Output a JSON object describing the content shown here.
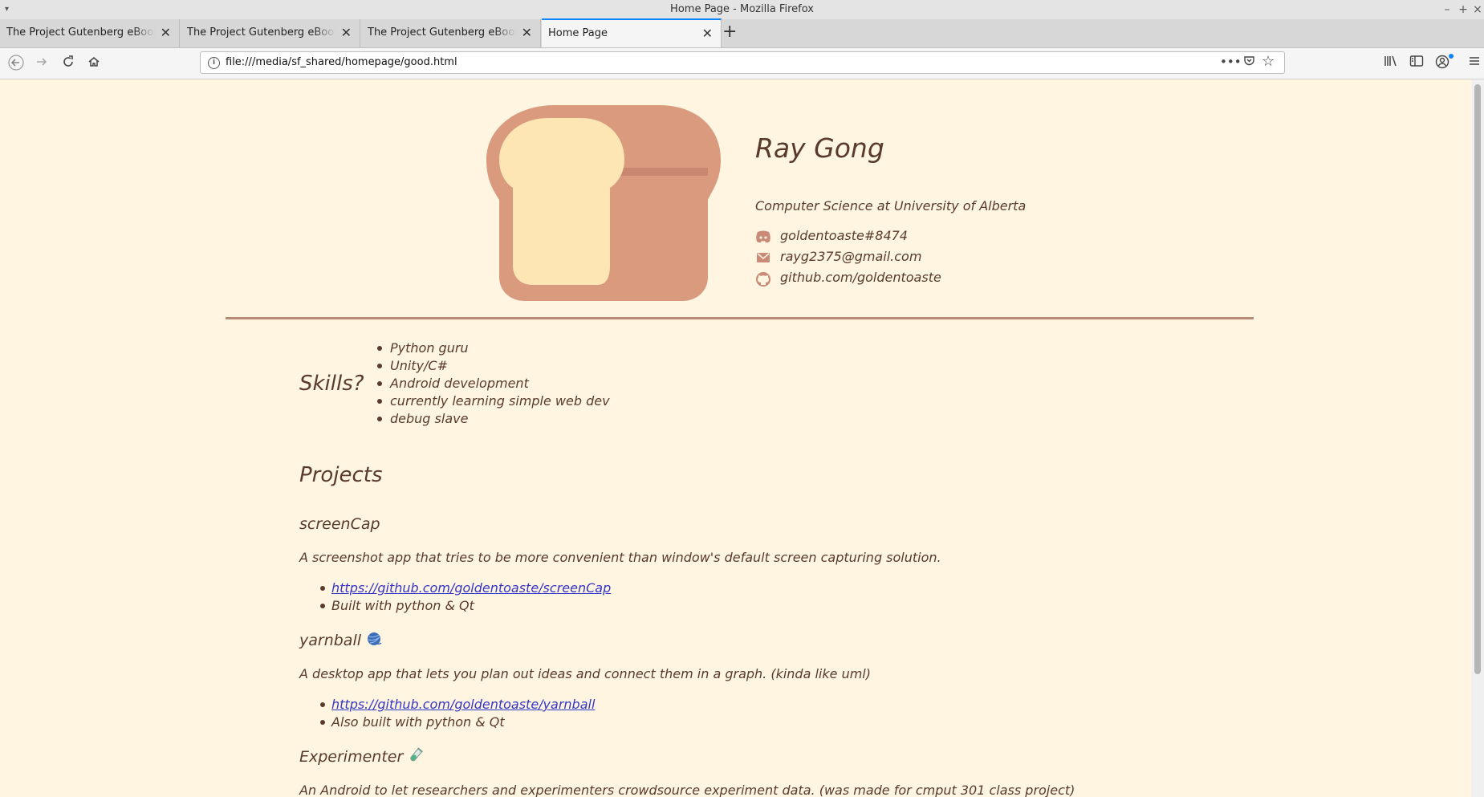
{
  "window": {
    "title": "Home Page - Mozilla Firefox"
  },
  "tabs": [
    {
      "label": "The Project Gutenberg eBook of",
      "active": false
    },
    {
      "label": "The Project Gutenberg eBook of",
      "active": false
    },
    {
      "label": "The Project Gutenberg eBook of",
      "active": false
    },
    {
      "label": "Home Page",
      "active": true
    }
  ],
  "navbar": {
    "url": "file:///media/sf_shared/homepage/good.html"
  },
  "profile": {
    "name": "Ray Gong",
    "subtitle": "Computer Science at University of Alberta",
    "contacts": [
      {
        "icon": "discord-icon",
        "text": "goldentoaste#8474"
      },
      {
        "icon": "mail-icon",
        "text": "rayg2375@gmail.com"
      },
      {
        "icon": "github-icon",
        "text": "github.com/goldentoaste"
      }
    ]
  },
  "skills": {
    "title": "Skills?",
    "items": [
      "Python guru",
      "Unity/C#",
      "Android development",
      "currently learning simple web dev",
      "debug slave"
    ]
  },
  "projects": {
    "title": "Projects",
    "items": [
      {
        "name": "screenCap",
        "emoji": "",
        "description": "A screenshot app that tries to be more convenient than window's default screen capturing solution.",
        "link": "https://github.com/goldentoaste/screenCap",
        "note": "Built with python & Qt"
      },
      {
        "name": "yarnball",
        "emoji": "yarn-ball-icon",
        "description": "A desktop app that lets you plan out ideas and connect them in a graph. (kinda like uml)",
        "link": "https://github.com/goldentoaste/yarnball",
        "note": "Also built with python & Qt"
      },
      {
        "name": "Experimenter",
        "emoji": "test-tube-icon",
        "description": "An Android to let researchers and experimenters crowdsource experiment data. (was made for cmput 301 class project)"
      }
    ]
  },
  "colors": {
    "background": "#fff5e0",
    "text": "#5a3a2a",
    "divider": "#b98a78",
    "toast_crust": "#d99a7e",
    "toast_bread": "#fee6b4",
    "link": "#3535c8"
  }
}
